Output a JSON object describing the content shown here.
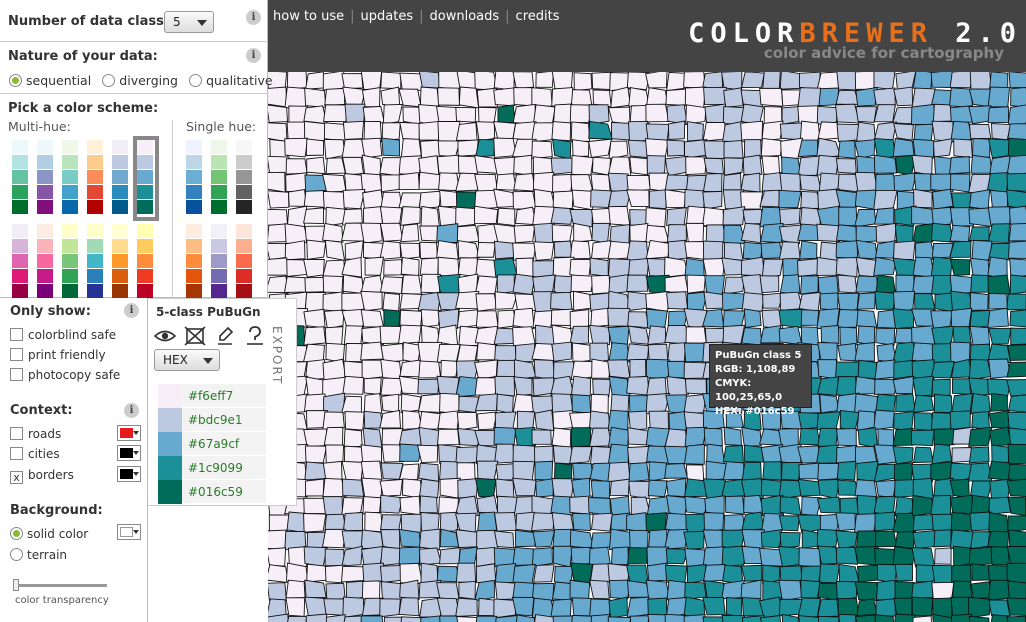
{
  "header": {
    "nav": [
      "how to use",
      "updates",
      "downloads",
      "credits"
    ],
    "logo_part1": "COLOR",
    "logo_part2": "BREWER",
    "logo_part3": " 2.0",
    "tagline": "color advice for cartography",
    "logo_accent_color": "#e8701a"
  },
  "controls": {
    "num_classes_label": "Number of data classes:",
    "num_classes_value": "5",
    "nature_label": "Nature of your data:",
    "nature_options": [
      "sequential",
      "diverging",
      "qualitative"
    ],
    "nature_selected": "sequential",
    "pick_scheme_label": "Pick a color scheme:",
    "multihue_label": "Multi-hue:",
    "singlehue_label": "Single hue:",
    "info_glyph": "i"
  },
  "filters": {
    "only_show_label": "Only show:",
    "options": [
      "colorblind safe",
      "print friendly",
      "photocopy safe"
    ]
  },
  "context": {
    "label": "Context:",
    "items": [
      {
        "label": "roads",
        "checked": false,
        "color": "#e41a1c"
      },
      {
        "label": "cities",
        "checked": false,
        "color": "#000000"
      },
      {
        "label": "borders",
        "checked": true,
        "color": "#000000"
      }
    ],
    "check_glyph": "x"
  },
  "background": {
    "label": "Background:",
    "options": [
      "solid color",
      "terrain"
    ],
    "selected": "solid color",
    "transparency_label": "color transparency"
  },
  "export": {
    "title": "5-class PuBuGn",
    "format": "HEX",
    "side_label": "EXPORT",
    "icons": [
      "eye-icon",
      "colorblind-icon",
      "print-icon",
      "photocopy-icon"
    ],
    "colors": [
      "#f6eff7",
      "#bdc9e1",
      "#67a9cf",
      "#1c9099",
      "#016c59"
    ],
    "hex_labels": [
      "#f6eff7",
      "#bdc9e1",
      "#67a9cf",
      "#1c9099",
      "#016c59"
    ]
  },
  "tooltip": {
    "title": "PuBuGn class 5",
    "rgb": "RGB: 1,108,89",
    "cmyk": "CMYK: 100,25,65,0",
    "hex": "HEX: #016c59"
  },
  "schemes": {
    "multihue_row1": [
      [
        "#edf8fb",
        "#b2e2e2",
        "#66c2a4",
        "#2ca25f",
        "#006d2c"
      ],
      [
        "#edf8fb",
        "#b3cde3",
        "#8c96c6",
        "#8856a7",
        "#810f7c"
      ],
      [
        "#f0f9e8",
        "#bae4bc",
        "#7bccc4",
        "#43a2ca",
        "#0868ac"
      ],
      [
        "#fef0d9",
        "#fdcc8a",
        "#fc8d59",
        "#e34a33",
        "#b30000"
      ],
      [
        "#f1eef6",
        "#bdc9e1",
        "#74a9cf",
        "#2b8cbe",
        "#045a8d"
      ],
      [
        "#f6eff7",
        "#bdc9e1",
        "#67a9cf",
        "#1c9099",
        "#016c59"
      ]
    ],
    "multihue_row2": [
      [
        "#f1eef6",
        "#d7b5d8",
        "#df65b0",
        "#dd1c77",
        "#980043"
      ],
      [
        "#feebe2",
        "#fbb4b9",
        "#f768a1",
        "#c51b8a",
        "#7a0177"
      ],
      [
        "#ffffcc",
        "#c2e699",
        "#78c679",
        "#31a354",
        "#006837"
      ],
      [
        "#ffffcc",
        "#a1dab4",
        "#41b6c4",
        "#2c7fb8",
        "#253494"
      ],
      [
        "#ffffd4",
        "#fed98e",
        "#fe9929",
        "#d95f0e",
        "#993404"
      ],
      [
        "#ffffb2",
        "#fecc5c",
        "#fd8d3c",
        "#f03b20",
        "#bd0026"
      ]
    ],
    "singlehue_row1": [
      [
        "#eff3ff",
        "#bdd7e7",
        "#6baed6",
        "#3182bd",
        "#08519c"
      ],
      [
        "#edf8e9",
        "#bae4b3",
        "#74c476",
        "#31a354",
        "#006d2c"
      ],
      [
        "#f7f7f7",
        "#cccccc",
        "#969696",
        "#636363",
        "#252525"
      ]
    ],
    "singlehue_row2": [
      [
        "#feedde",
        "#fdbe85",
        "#fd8d3c",
        "#e6550d",
        "#a63603"
      ],
      [
        "#f2f0f7",
        "#cbc9e2",
        "#9e9ac8",
        "#756bb1",
        "#54278f"
      ],
      [
        "#fee5d9",
        "#fcae91",
        "#fb6a4a",
        "#de2d26",
        "#a50f15"
      ]
    ]
  }
}
